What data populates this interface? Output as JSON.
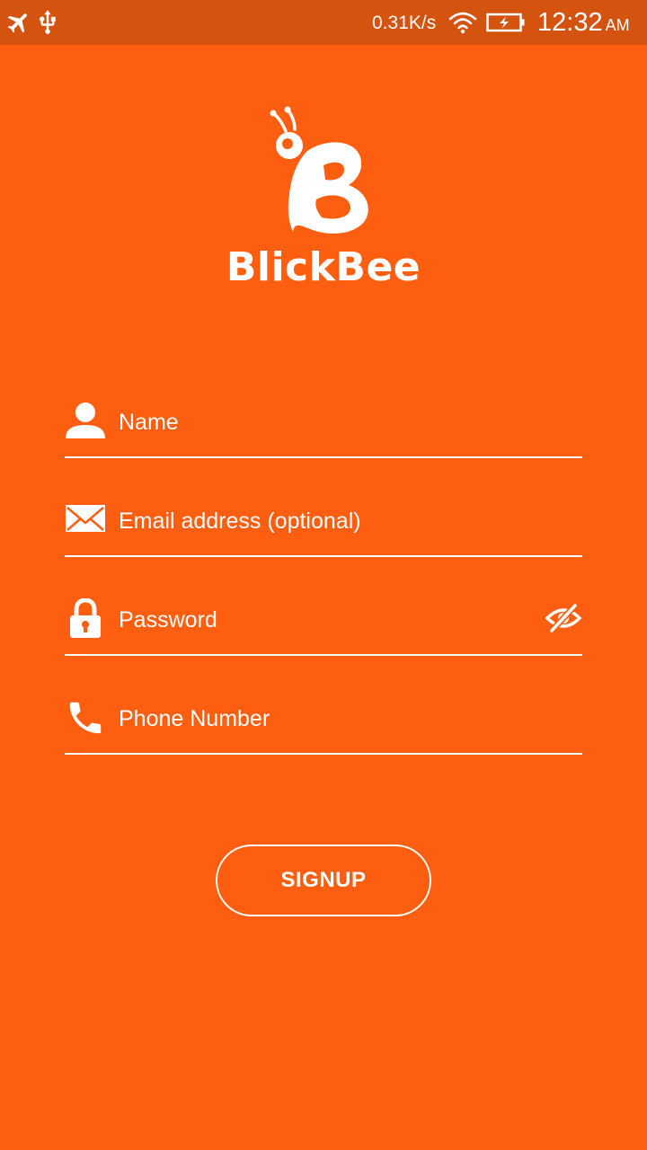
{
  "status_bar": {
    "icons": [
      "airplane-mode-icon",
      "usb-icon",
      "wifi-icon",
      "battery-charging-icon"
    ],
    "network_speed": "0.31K/s",
    "time": "12:32",
    "ampm": "AM"
  },
  "brand": {
    "logo_icon": "bee-logo-icon",
    "name": "BlickBee"
  },
  "form": {
    "name": {
      "icon": "person-icon",
      "placeholder": "Name",
      "value": ""
    },
    "email": {
      "icon": "envelope-icon",
      "placeholder": "Email address (optional)",
      "value": ""
    },
    "password": {
      "icon": "lock-icon",
      "placeholder": "Password",
      "value": "",
      "toggle_icon": "eye-off-icon"
    },
    "phone": {
      "icon": "phone-icon",
      "placeholder": "Phone Number",
      "value": ""
    }
  },
  "signup_label": "SIGNUP",
  "colors": {
    "background": "#fd5e0f",
    "status_bar": "#d4530f",
    "foreground": "#ffffff"
  }
}
